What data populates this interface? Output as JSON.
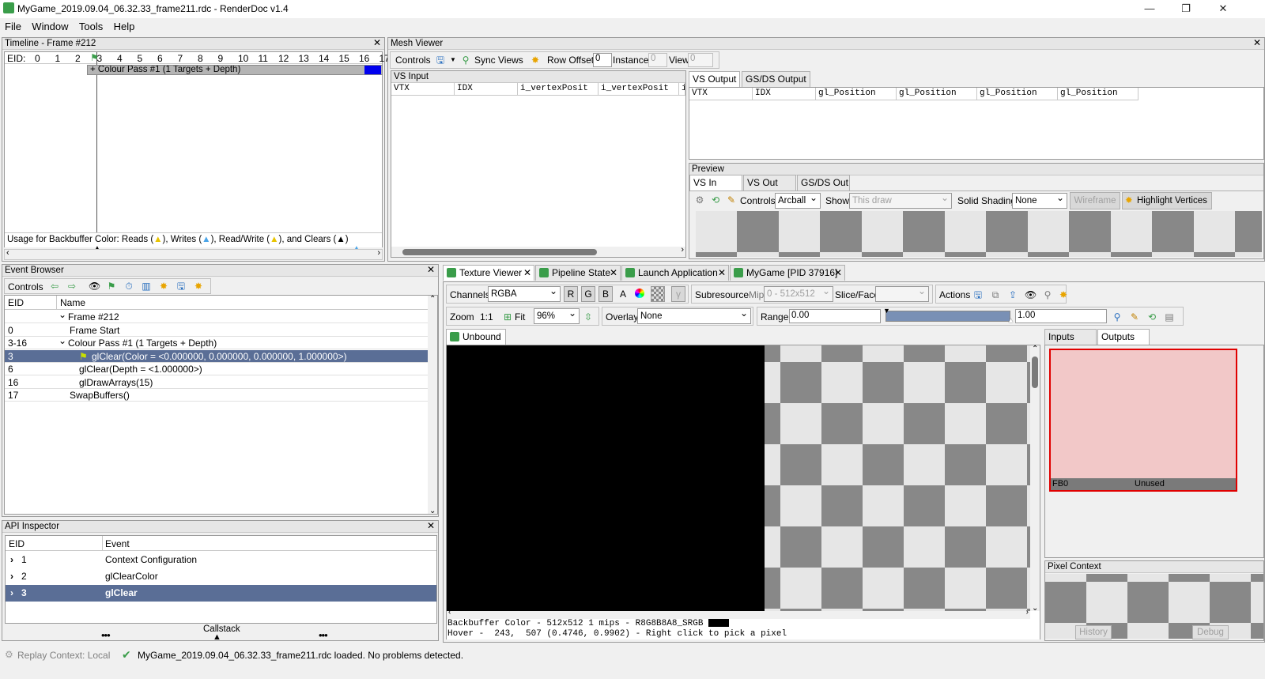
{
  "window": {
    "title": "MyGame_2019.09.04_06.32.33_frame211.rdc - RenderDoc v1.4",
    "minimize": "—",
    "maximize": "❐",
    "close": "✕"
  },
  "menu": [
    "File",
    "Window",
    "Tools",
    "Help"
  ],
  "timeline": {
    "title": "Timeline - Frame #212",
    "eid_label": "EID:",
    "eids": [
      "0",
      "1",
      "2",
      "3",
      "4",
      "5",
      "6",
      "7",
      "8",
      "9",
      "10",
      "11",
      "12",
      "13",
      "14",
      "15",
      "16",
      "17"
    ],
    "pass_label": "+ Colour Pass #1 (1 Targets + Depth)",
    "usage": {
      "prefix": "Usage for Backbuffer Color: Reads (",
      "writes": "), Writes (",
      "readwrite": "), Read/Write (",
      "clears": "), and Clears (",
      "suffix": ")"
    }
  },
  "mesh_viewer": {
    "title": "Mesh Viewer",
    "controls": "Controls",
    "sync_views": "Sync Views",
    "row_offset": "Row Offset",
    "row_offset_value": "0",
    "instance": "Instance",
    "instance_value": "0",
    "view": "View",
    "view_value": "0",
    "vs_input": {
      "title": "VS Input",
      "columns": [
        "VTX",
        "IDX",
        "i_vertexPosit",
        "i_vertexPosit",
        "i"
      ]
    },
    "output_tabs": [
      "VS Output",
      "GS/DS Output"
    ],
    "vs_output_columns": [
      "VTX",
      "IDX",
      "gl_Position",
      "gl_Position",
      "gl_Position",
      "gl_Position"
    ],
    "preview": {
      "title": "Preview",
      "tabs": [
        "VS In",
        "VS Out",
        "GS/DS Out"
      ],
      "controls": "Controls",
      "controls_value": "Arcball",
      "show": "Show",
      "show_value": "This draw",
      "solid_shading": "Solid Shading",
      "solid_shading_value": "None",
      "wireframe": "Wireframe",
      "highlight_vertices": "Highlight Vertices"
    }
  },
  "event_browser": {
    "title": "Event Browser",
    "controls": "Controls",
    "columns": [
      "EID",
      "Name"
    ],
    "rows": [
      {
        "eid": "",
        "name": "Frame #212",
        "indent": 0,
        "expander": "⌄"
      },
      {
        "eid": "0",
        "name": "Frame Start",
        "indent": 1,
        "expander": ""
      },
      {
        "eid": "3-16",
        "name": "Colour Pass #1 (1 Targets + Depth)",
        "indent": 0,
        "expander": "⌄"
      },
      {
        "eid": "3",
        "name": "glClear(Color = <0.000000, 0.000000, 0.000000, 1.000000>)",
        "indent": 2,
        "expander": "",
        "selected": true
      },
      {
        "eid": "6",
        "name": "glClear(Depth = <1.000000>)",
        "indent": 2,
        "expander": ""
      },
      {
        "eid": "16",
        "name": "glDrawArrays(15)",
        "indent": 2,
        "expander": ""
      },
      {
        "eid": "17",
        "name": "SwapBuffers()",
        "indent": 1,
        "expander": ""
      }
    ]
  },
  "api_inspector": {
    "title": "API Inspector",
    "columns": [
      "EID",
      "Event"
    ],
    "rows": [
      {
        "eid": "1",
        "event": "Context Configuration"
      },
      {
        "eid": "2",
        "event": "glClearColor"
      },
      {
        "eid": "3",
        "event": "glClear",
        "selected": true
      }
    ],
    "callstack": "Callstack",
    "dots": "•••"
  },
  "doc_tabs": [
    "Texture Viewer",
    "Pipeline State",
    "Launch Application",
    "MyGame [PID 37916]"
  ],
  "texture_viewer": {
    "channels": "Channels",
    "channels_value": "RGBA",
    "r": "R",
    "g": "G",
    "b": "B",
    "a": "A",
    "subresource": "Subresource",
    "mip": "Mip",
    "mip_value": "0 - 512x512",
    "slice_face": "Slice/Face",
    "actions": "Actions",
    "zoom": "Zoom",
    "one_to_one": "1:1",
    "fit": "Fit",
    "zoom_value": "96%",
    "overlay": "Overlay",
    "overlay_value": "None",
    "range": "Range",
    "range_min": "0.00",
    "range_max": "1.00",
    "unbound_tab": "Unbound",
    "info_line": "Backbuffer Color - 512x512 1 mips - R8G8B8A8_SRGB",
    "hover_line": "Hover -  243,  507 (0.4746, 0.9902) - Right click to pick a pixel",
    "side_tabs": [
      "Inputs",
      "Outputs"
    ],
    "thumb_name": "FB0",
    "thumb_status": "Unused",
    "pixel_context": "Pixel Context",
    "history": "History",
    "debug": "Debug"
  },
  "status_bar": {
    "replay_context": "Replay Context: Local",
    "message": "MyGame_2019.09.04_06.32.33_frame211.rdc loaded. No problems detected."
  },
  "colors": {
    "selection": "#5a6e96",
    "thumb_fill": "#f2c8c8",
    "thumb_border": "#e00000",
    "accent_green": "#3a9d4a",
    "timeline_marker": "#0000ee"
  }
}
